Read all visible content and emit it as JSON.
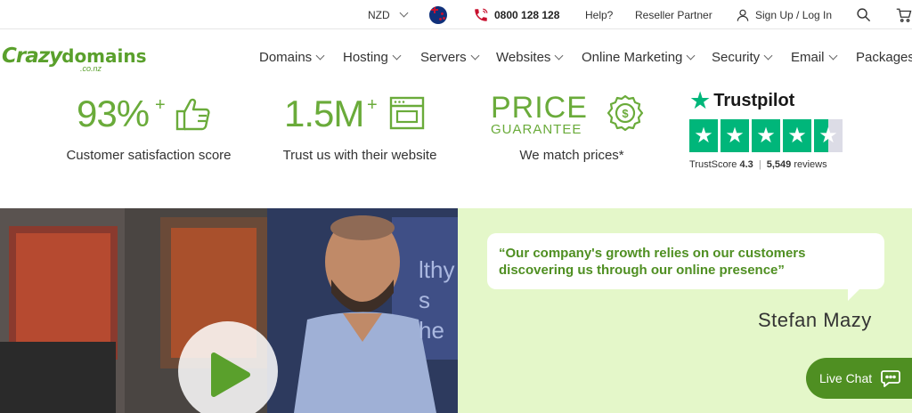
{
  "topbar": {
    "currency": "NZD",
    "phone": "0800 128 128",
    "help": "Help?",
    "reseller": "Reseller Partner",
    "signup": "Sign Up / Log In"
  },
  "logo": {
    "word1": "Crazy",
    "word2": "domains",
    "tld": ".co.nz"
  },
  "nav": {
    "items": [
      {
        "label": "Domains"
      },
      {
        "label": "Hosting"
      },
      {
        "label": "Servers"
      },
      {
        "label": "Websites"
      },
      {
        "label": "Online Marketing"
      },
      {
        "label": "Security"
      },
      {
        "label": "Email"
      },
      {
        "label": "Packages"
      }
    ]
  },
  "stats": {
    "satisfaction": {
      "value": "93%",
      "sup": "+",
      "caption": "Customer satisfaction score"
    },
    "websites": {
      "value": "1.5M",
      "sup": "+",
      "caption": "Trust us with their website"
    },
    "price": {
      "line1": "PRICE",
      "line2": "GUARANTEE",
      "caption": "We match prices*"
    }
  },
  "trustpilot": {
    "brand": "Trustpilot",
    "score_label": "TrustScore",
    "score": "4.3",
    "separator": "|",
    "reviews_count": "5,549",
    "reviews_label": "reviews",
    "stars": 4.3
  },
  "testimonial": {
    "quote_line1": "“Our company's growth relies on our customers",
    "quote_line2": "discovering us through our online presence”",
    "author": "Stefan Mazy"
  },
  "video": {
    "sign_line1": "lthy",
    "sign_line2": "s he"
  },
  "livechat": {
    "label": "Live Chat"
  },
  "colors": {
    "brand_green": "#6aab3a",
    "dark_green": "#4f8f22",
    "trustpilot_green": "#00b67a",
    "testimonial_bg": "#e4f7c9"
  }
}
